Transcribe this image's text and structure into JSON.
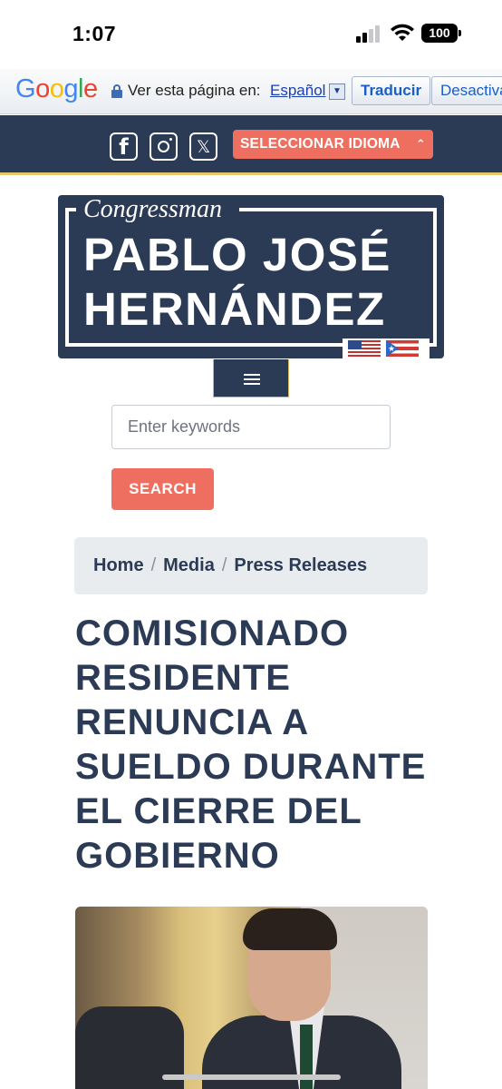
{
  "status_bar": {
    "time": "1:07",
    "battery": "100"
  },
  "translate_bar": {
    "logo": "Google",
    "prompt": "Ver esta página en:",
    "language": "Español",
    "translate_label": "Traducir",
    "deactivate_label": "Desactiva"
  },
  "header": {
    "social": [
      "facebook-icon",
      "instagram-icon",
      "x-icon"
    ],
    "language_select": "SELECCIONAR IDIOMA",
    "colors": {
      "navy": "#2b3a55",
      "coral": "#ee6f60",
      "gold": "#e8c76a"
    }
  },
  "logo": {
    "title": "Congressman",
    "name_line1": "PABLO JOSÉ",
    "name_line2": "HERNÁNDEZ"
  },
  "search": {
    "placeholder": "Enter keywords",
    "button_label": "SEARCH"
  },
  "breadcrumb": {
    "items": [
      "Home",
      "Media",
      "Press Releases"
    ],
    "separator": "/"
  },
  "article": {
    "title": "COMISIONADO RESIDENTE RENUNCIA A SUELDO DURANTE EL CIERRE DEL GOBIERNO"
  }
}
